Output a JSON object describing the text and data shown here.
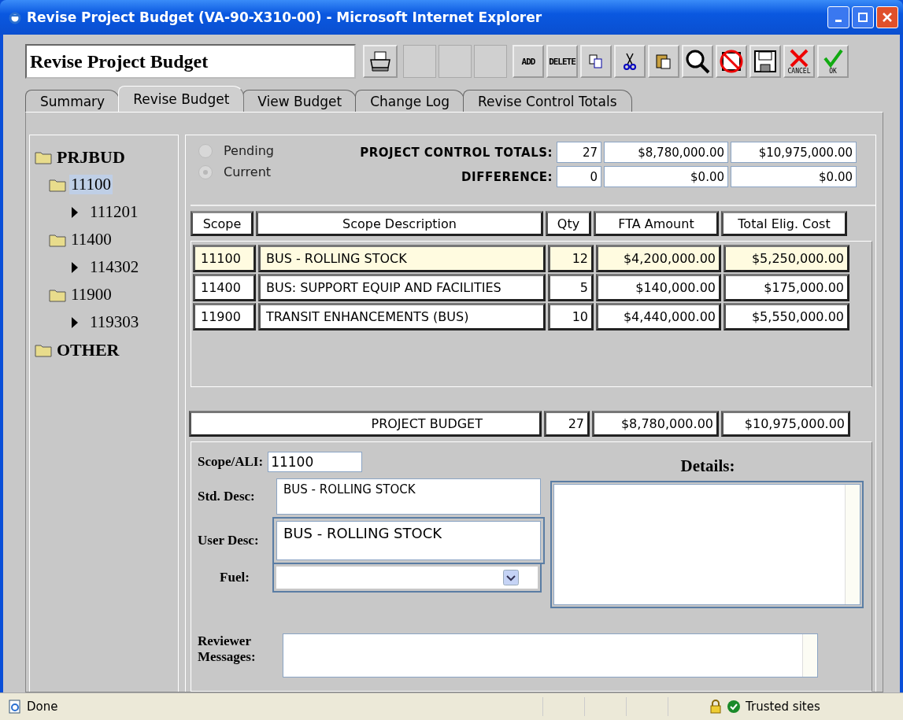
{
  "window": {
    "title": "Revise Project Budget (VA-90-X310-00) - Microsoft Internet Explorer"
  },
  "toolbar": {
    "title": "Revise Project Budget",
    "buttons": [
      {
        "kind": "print"
      },
      {
        "kind": "blank"
      },
      {
        "kind": "blank"
      },
      {
        "kind": "blank"
      },
      {
        "kind": "text",
        "label": "ADD"
      },
      {
        "kind": "text",
        "label": "DELETE"
      },
      {
        "kind": "copy"
      },
      {
        "kind": "cut"
      },
      {
        "kind": "paste"
      },
      {
        "kind": "search"
      },
      {
        "kind": "nosave"
      },
      {
        "kind": "save"
      },
      {
        "kind": "cancel",
        "label": "CANCEL"
      },
      {
        "kind": "ok",
        "label": "OK"
      }
    ]
  },
  "tabs": [
    {
      "label": "Summary",
      "selected": false
    },
    {
      "label": "Revise Budget",
      "selected": true
    },
    {
      "label": "View Budget",
      "selected": false
    },
    {
      "label": "Change Log",
      "selected": false
    },
    {
      "label": "Revise Control Totals",
      "selected": false
    }
  ],
  "tree": [
    {
      "label": "PRJBUD",
      "kind": "root",
      "selected": false,
      "children": [
        {
          "label": "11100",
          "kind": "folder",
          "selected": true,
          "children": [
            {
              "label": "111201",
              "kind": "leaf",
              "selected": false
            }
          ]
        },
        {
          "label": "11400",
          "kind": "folder",
          "selected": false,
          "children": [
            {
              "label": "114302",
              "kind": "leaf",
              "selected": false
            }
          ]
        },
        {
          "label": "11900",
          "kind": "folder",
          "selected": false,
          "children": [
            {
              "label": "119303",
              "kind": "leaf",
              "selected": false
            }
          ]
        }
      ]
    },
    {
      "label": "OTHER",
      "kind": "root",
      "selected": false
    }
  ],
  "status_options": [
    {
      "label": "Pending",
      "selected": false,
      "disabled": true
    },
    {
      "label": "Current",
      "selected": true,
      "disabled": true
    }
  ],
  "totals": [
    {
      "label": "PROJECT CONTROL TOTALS:",
      "values": [
        "27",
        "$8,780,000.00",
        "$10,975,000.00"
      ]
    },
    {
      "label": "DIFFERENCE:",
      "values": [
        "0",
        "$0.00",
        "$0.00"
      ]
    }
  ],
  "table": {
    "columns": [
      "Scope",
      "Scope Description",
      "Qty",
      "FTA Amount",
      "Total Elig. Cost"
    ],
    "rows": [
      {
        "selected": true,
        "cells": [
          "11100",
          "BUS - ROLLING STOCK",
          "12",
          "$4,200,000.00",
          "$5,250,000.00"
        ]
      },
      {
        "selected": false,
        "cells": [
          "11400",
          "BUS:  SUPPORT EQUIP AND FACILITIES",
          "5",
          "$140,000.00",
          "$175,000.00"
        ]
      },
      {
        "selected": false,
        "cells": [
          "11900",
          "TRANSIT ENHANCEMENTS (BUS)",
          "10",
          "$4,440,000.00",
          "$5,550,000.00"
        ]
      }
    ]
  },
  "budget_total": {
    "label": "PROJECT BUDGET",
    "values": [
      "27",
      "$8,780,000.00",
      "$10,975,000.00"
    ]
  },
  "form": {
    "scope_ali": {
      "label": "Scope/ALI:",
      "value": "11100"
    },
    "std_desc": {
      "label": "Std. Desc:",
      "value": "BUS - ROLLING STOCK"
    },
    "user_desc": {
      "label": "User Desc:",
      "value": "BUS - ROLLING STOCK"
    },
    "fuel": {
      "label": "Fuel:"
    },
    "details": {
      "label": "Details:"
    },
    "reviewer_messages": {
      "label": "Reviewer Messages:"
    }
  },
  "status_bar": {
    "text": "Done",
    "zone": "Trusted sites"
  }
}
